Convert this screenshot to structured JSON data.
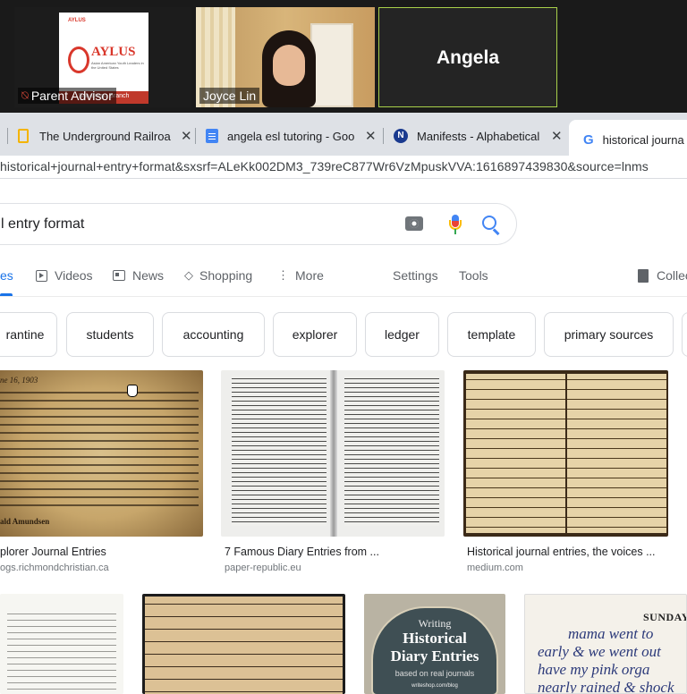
{
  "zoom": {
    "tiles": [
      {
        "name": "Parent Advisor",
        "logo_small": "AYLUS",
        "logo": "AYLUS",
        "logo_sub": "Asian American Youth Leaders in the United States",
        "logo_banner": "San Diego Branch"
      },
      {
        "name": "Joyce Lin"
      },
      {
        "name": "Angela"
      }
    ]
  },
  "browser": {
    "tabs": [
      {
        "label": "The Underground Railroa",
        "icon": "bookmark-icon"
      },
      {
        "label": "angela esl tutoring - Goo",
        "icon": "docs-icon"
      },
      {
        "label": "Manifests - Alphabetical",
        "icon": "n-icon"
      },
      {
        "label": "historical journa",
        "icon": "google-icon",
        "active": true
      }
    ],
    "url": "historical+journal+entry+format&sxsrf=ALeKk002DM3_739reC877Wr6VzMpuskVVA:1616897439830&source=lnms"
  },
  "search": {
    "query": "l entry format",
    "icons": [
      "camera-icon",
      "mic-icon",
      "search-icon"
    ]
  },
  "nav": {
    "images_partial": "es",
    "videos": "Videos",
    "news": "News",
    "shopping": "Shopping",
    "more": "More",
    "settings": "Settings",
    "tools": "Tools",
    "collections": "Collec"
  },
  "chips": [
    "rantine",
    "students",
    "accounting",
    "explorer",
    "ledger",
    "template",
    "primary sources"
  ],
  "results": [
    {
      "title": "plorer Journal Entries",
      "source": "ogs.richmondchristian.ca",
      "date_text": "ne 16, 1903",
      "sign_text": "ald Amundsen"
    },
    {
      "title": "7 Famous Diary Entries from ...",
      "source": "paper-republic.eu"
    },
    {
      "title": "Historical journal entries, the voices ...",
      "source": "medium.com"
    }
  ],
  "results_row2": {
    "badge_small": "Writing",
    "badge_line1": "Historical",
    "badge_line2": "Diary Entries",
    "badge_sub": "based on real journals",
    "badge_url": "writeshop.com/blog",
    "diary_header": "SUNDAY",
    "diary_line1": "mama went to",
    "diary_line2": "early & we went out",
    "diary_line3": "have my pink orga",
    "diary_line4": "nearly rained & shock"
  },
  "colors": {
    "accent": "#1a73e8",
    "tabbar": "#dee1e6",
    "zoom_bg": "#1a1a1a",
    "speaker_border": "#a9d14a"
  }
}
